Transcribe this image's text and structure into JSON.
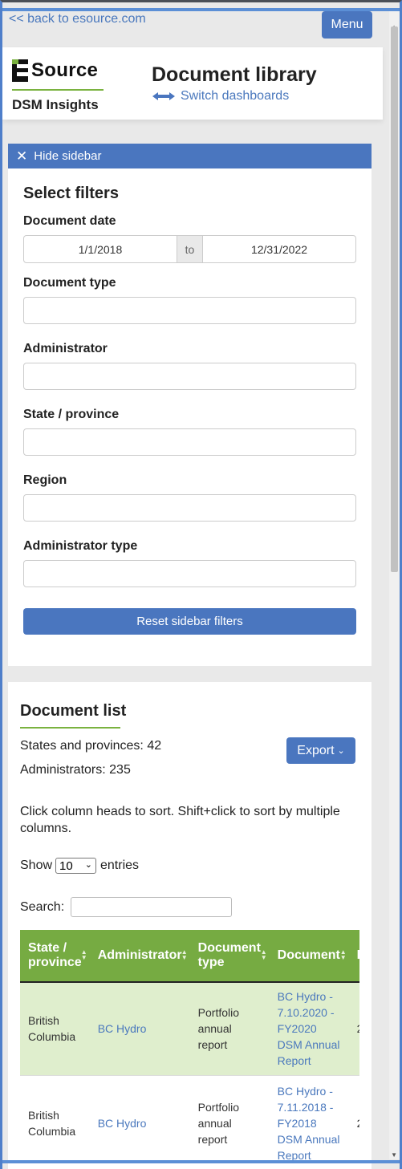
{
  "nav": {
    "back_link": "<< back to esource.com",
    "menu_label": "Menu"
  },
  "brand": {
    "logo_text": "Source",
    "sub": "DSM Insights"
  },
  "page": {
    "title": "Document library",
    "switch_label": "Switch dashboards"
  },
  "sidebar": {
    "hide_label": "Hide sidebar",
    "title": "Select filters",
    "date_label": "Document date",
    "date_from": "1/1/2018",
    "date_to_sep": "to",
    "date_to": "12/31/2022",
    "filters": [
      {
        "label": "Document type",
        "value": ""
      },
      {
        "label": "Administrator",
        "value": ""
      },
      {
        "label": "State / province",
        "value": ""
      },
      {
        "label": "Region",
        "value": ""
      },
      {
        "label": "Administrator type",
        "value": ""
      }
    ],
    "reset_label": "Reset sidebar filters"
  },
  "doclist": {
    "title": "Document list",
    "states_count": "States and provinces: 42",
    "admins_count": "Administrators: 235",
    "export_label": "Export",
    "hint": "Click column heads to sort. Shift+click to sort by multiple columns.",
    "show_label": "Show",
    "show_value": "10",
    "entries_label": "entries",
    "search_label": "Search:",
    "columns": [
      "State / province",
      "Administrator",
      "Document type",
      "Document",
      "D"
    ],
    "rows": [
      {
        "state": "British Columbia",
        "admin": "BC Hydro",
        "type": "Portfolio annual report",
        "doc": "BC Hydro - 7.10.2020 - FY2020 DSM Annual Report",
        "extra": "2"
      },
      {
        "state": "British Columbia",
        "admin": "BC Hydro",
        "type": "Portfolio annual report",
        "doc": "BC Hydro - 7.11.2018 - FY2018 DSM Annual Report",
        "extra": "2"
      }
    ]
  },
  "colors": {
    "accent_blue": "#4a76bf",
    "brand_green": "#76ab42",
    "row_highlight": "#dfeecd",
    "link": "#4a78bd"
  }
}
